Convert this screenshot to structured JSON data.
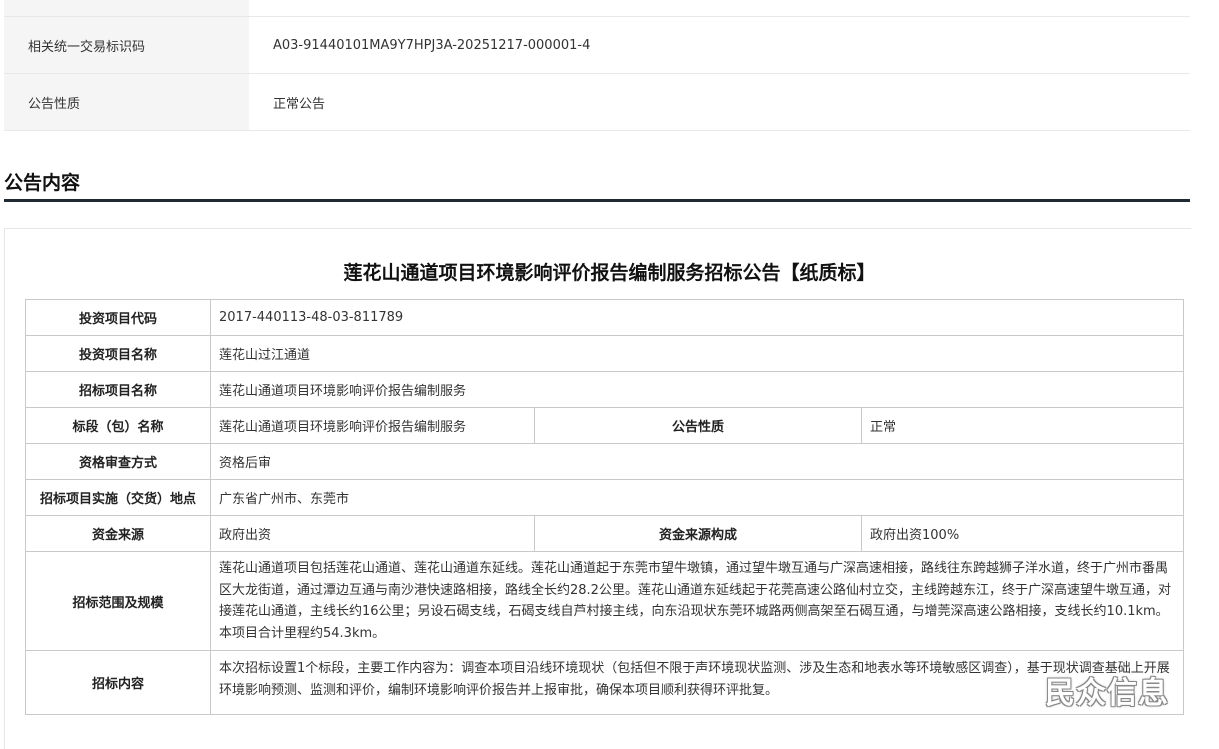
{
  "info_rows": [
    {
      "label": "相关统一交易标识码",
      "value": "A03-91440101MA9Y7HPJ3A-20251217-000001-4"
    },
    {
      "label": "公告性质",
      "value": "正常公告"
    }
  ],
  "section_title": "公告内容",
  "doc_title": "莲花山通道项目环境影响评价报告编制服务招标公告【纸质标】",
  "table": {
    "r1": {
      "label": "投资项目代码",
      "value": "2017-440113-48-03-811789"
    },
    "r2": {
      "label": "投资项目名称",
      "value": "莲花山过江通道"
    },
    "r3": {
      "label": "招标项目名称",
      "value": "莲花山通道项目环境影响评价报告编制服务"
    },
    "r4": {
      "label": "标段（包）名称",
      "value": "莲花山通道项目环境影响评价报告编制服务",
      "label2": "公告性质",
      "value2": "正常"
    },
    "r5": {
      "label": "资格审查方式",
      "value": "资格后审"
    },
    "r6": {
      "label": "招标项目实施（交货）地点",
      "value": "广东省广州市、东莞市"
    },
    "r7": {
      "label": "资金来源",
      "value": "政府出资",
      "label2": "资金来源构成",
      "value2": "政府出资100%"
    },
    "r8": {
      "label": "招标范围及规模",
      "value": "莲花山通道项目包括莲花山通道、莲花山通道东延线。莲花山通道起于东莞市望牛墩镇，通过望牛墩互通与广深高速相接，路线往东跨越狮子洋水道，终于广州市番禺区大龙街道，通过潭边互通与南沙港快速路相接，路线全长约28.2公里。莲花山通道东延线起于花莞高速公路仙村立交，主线跨越东江，终于广深高速望牛墩互通，对接莲花山通道，主线长约16公里；另设石碣支线，石碣支线自芦村接主线，向东沿现状东莞环城路两侧高架至石碣互通，与增莞深高速公路相接，支线长约10.1km。本项目合计里程约54.3km。"
    },
    "r9": {
      "label": "招标内容",
      "value": "本次招标设置1个标段，主要工作内容为：调查本项目沿线环境现状（包括但不限于声环境现状监测、涉及生态和地表水等环境敏感区调查），基于现状调查基础上开展环境影响预测、监测和评价，编制环境影响评价报告并上报审批，确保本项目顺利获得环评批复。"
    }
  },
  "watermark": "民众信息"
}
